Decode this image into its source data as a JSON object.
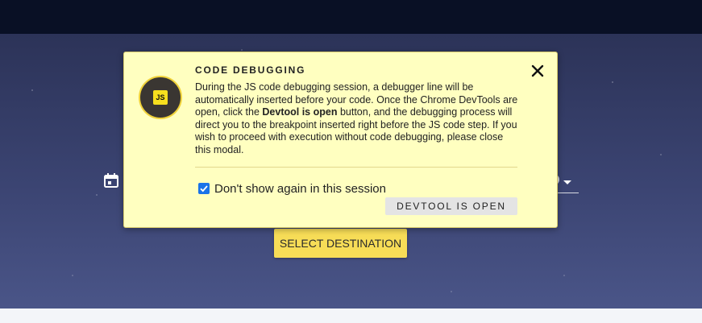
{
  "modal": {
    "badge_text": "JS",
    "title": "CODE DEBUGGING",
    "body": {
      "part1": "During the JS code debugging session, a debugger line will be automatically inserted before your code. Once the Chrome DevTools are open, click the ",
      "bold": "Devtool is open",
      "part2": " button, and the debugging process will direct you to the breakpoint inserted right before the JS code step. If you wish to proceed with execution without code debugging, please close this modal."
    },
    "checkbox_label": "Don't show again in this session",
    "checkbox_checked": true,
    "primary_button": "DEVTOOL IS OPEN",
    "close_icon": "close-icon"
  },
  "page": {
    "select_button": "SELECT DESTINATION",
    "date_icon": "calendar-icon"
  },
  "colors": {
    "topbar": "#091025",
    "modal_bg": "#ffffc0",
    "js_yellow": "#f7df1e",
    "select_button_bg": "#f7dd57",
    "checkbox": "#1a73e8"
  }
}
